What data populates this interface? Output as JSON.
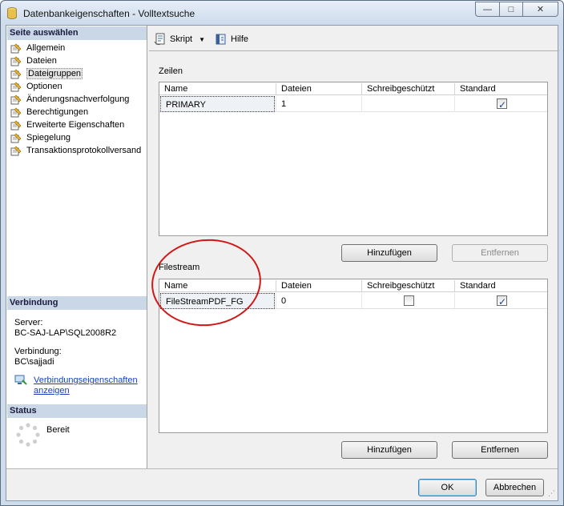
{
  "window": {
    "title": "Datenbankeigenschaften - Volltextsuche",
    "controls": {
      "minimize": "—",
      "maximize": "□",
      "close": "✕"
    }
  },
  "left_pane": {
    "select_page_header": "Seite auswählen",
    "items": [
      {
        "label": "Allgemein",
        "selected": false
      },
      {
        "label": "Dateien",
        "selected": false
      },
      {
        "label": "Dateigruppen",
        "selected": true
      },
      {
        "label": "Optionen",
        "selected": false
      },
      {
        "label": "Änderungsnachverfolgung",
        "selected": false
      },
      {
        "label": "Berechtigungen",
        "selected": false
      },
      {
        "label": "Erweiterte Eigenschaften",
        "selected": false
      },
      {
        "label": "Spiegelung",
        "selected": false
      },
      {
        "label": "Transaktionsprotokollversand",
        "selected": false
      }
    ],
    "connection_header": "Verbindung",
    "server_label": "Server:",
    "server_value": "BC-SAJ-LAP\\SQL2008R2",
    "connection_label": "Verbindung:",
    "connection_value": "BC\\sajjadi",
    "connection_link_line1": "Verbindungseigenschaften",
    "connection_link_line2": "anzeigen",
    "status_header": "Status",
    "status_value": "Bereit"
  },
  "toolbar": {
    "script_label": "Skript",
    "help_label": "Hilfe"
  },
  "rows_section": {
    "label": "Zeilen",
    "columns": [
      "Name",
      "Dateien",
      "Schreibgeschützt",
      "Standard"
    ],
    "rows": [
      {
        "name": "PRIMARY",
        "files": "1",
        "readonly": null,
        "default": true
      }
    ],
    "add_button": "Hinzufügen",
    "remove_button": "Entfernen"
  },
  "filestream_section": {
    "label": "Filestream",
    "columns": [
      "Name",
      "Dateien",
      "Schreibgeschützt",
      "Standard"
    ],
    "rows": [
      {
        "name": "FileStreamPDF_FG",
        "files": "0",
        "readonly": false,
        "default": true
      }
    ],
    "add_button": "Hinzufügen",
    "remove_button": "Entfernen"
  },
  "footer": {
    "ok_button": "OK",
    "cancel_button": "Abbrechen"
  },
  "colors": {
    "annotation_circle": "#d01818",
    "link": "#1a3dc1",
    "pane_header": "#cad7e6"
  }
}
